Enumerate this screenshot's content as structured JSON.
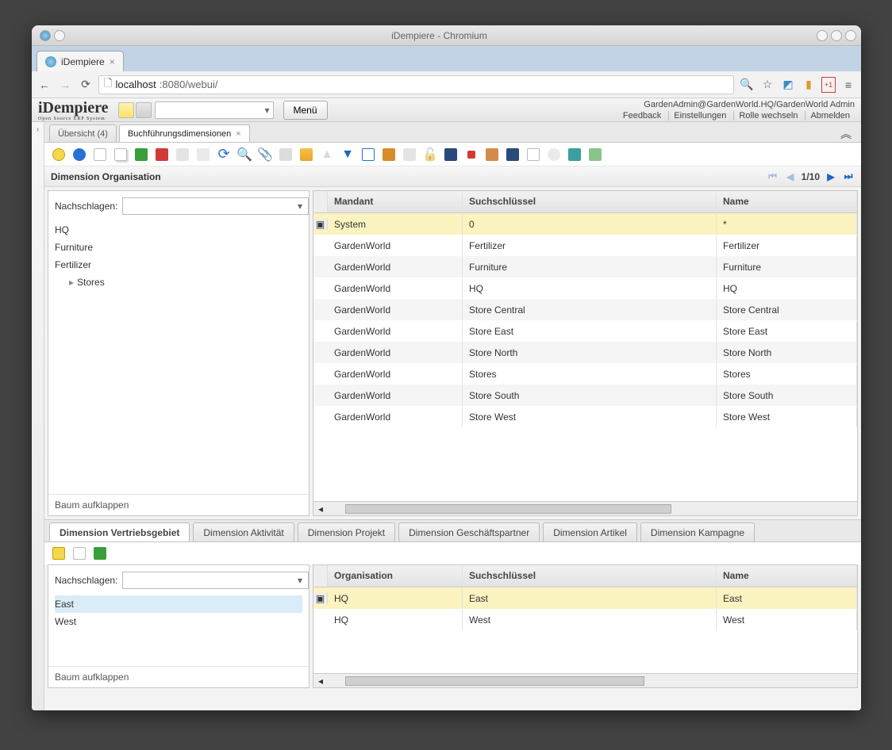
{
  "window_title": "iDempiere - Chromium",
  "browser_tab": "iDempiere",
  "url": {
    "host": "localhost",
    "port_path": ":8080/webui/"
  },
  "header": {
    "logo": "iDempiere",
    "logo_sub": "Open Source ERP System",
    "menu_btn": "Menü",
    "user": "GardenAdmin@GardenWorld.HQ/GardenWorld Admin",
    "links": [
      "Feedback",
      "Einstellungen",
      "Rolle wechseln",
      "Abmelden"
    ]
  },
  "wintabs": {
    "overview": "Übersicht (4)",
    "active": "Buchführungsdimensionen"
  },
  "pane_title": "Dimension Organisation",
  "pager": "1/10",
  "lookup_label": "Nachschlagen:",
  "tree_items": [
    "HQ",
    "Furniture",
    "Fertilizer"
  ],
  "tree_parent": "Stores",
  "tree_expand": "Baum aufklappen",
  "table": {
    "headers": {
      "mandant": "Mandant",
      "key": "Suchschlüssel",
      "name": "Name"
    },
    "rows": [
      {
        "mandant": "System",
        "key": "0",
        "name": "*",
        "sel": true
      },
      {
        "mandant": "GardenWorld",
        "key": "Fertilizer",
        "name": "Fertilizer"
      },
      {
        "mandant": "GardenWorld",
        "key": "Furniture",
        "name": "Furniture"
      },
      {
        "mandant": "GardenWorld",
        "key": "HQ",
        "name": "HQ"
      },
      {
        "mandant": "GardenWorld",
        "key": "Store Central",
        "name": "Store Central"
      },
      {
        "mandant": "GardenWorld",
        "key": "Store East",
        "name": "Store East"
      },
      {
        "mandant": "GardenWorld",
        "key": "Store North",
        "name": "Store North"
      },
      {
        "mandant": "GardenWorld",
        "key": "Stores",
        "name": "Stores"
      },
      {
        "mandant": "GardenWorld",
        "key": "Store South",
        "name": "Store South"
      },
      {
        "mandant": "GardenWorld",
        "key": "Store West",
        "name": "Store West"
      }
    ]
  },
  "subtabs": [
    "Dimension Vertriebsgebiet",
    "Dimension Aktivität",
    "Dimension Projekt",
    "Dimension Geschäftspartner",
    "Dimension Artikel",
    "Dimension Kampagne"
  ],
  "lower_tree_items": [
    "East",
    "West"
  ],
  "lower_table": {
    "headers": {
      "org": "Organisation",
      "key": "Suchschlüssel",
      "name": "Name"
    },
    "rows": [
      {
        "org": "HQ",
        "key": "East",
        "name": "East",
        "sel": true
      },
      {
        "org": "HQ",
        "key": "West",
        "name": "West"
      }
    ]
  }
}
